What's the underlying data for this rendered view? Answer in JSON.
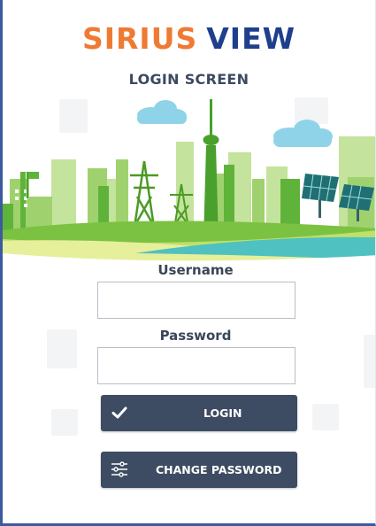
{
  "brand": {
    "name_part1": "SIRIUS",
    "name_part2": "VIEW",
    "color_primary": "#ef7a33",
    "color_secondary": "#1f3f8c"
  },
  "screen": {
    "subtitle": "LOGIN SCREEN"
  },
  "form": {
    "username_label": "Username",
    "username_value": "",
    "password_label": "Password",
    "password_value": ""
  },
  "buttons": {
    "login_label": "LOGIN",
    "login_icon": "checkmark-icon",
    "change_password_label": "CHANGE PASSWORD",
    "change_password_icon": "sliders-icon"
  },
  "colors": {
    "button_bg": "#3d4c62",
    "frame_border": "#3d5a9e"
  }
}
